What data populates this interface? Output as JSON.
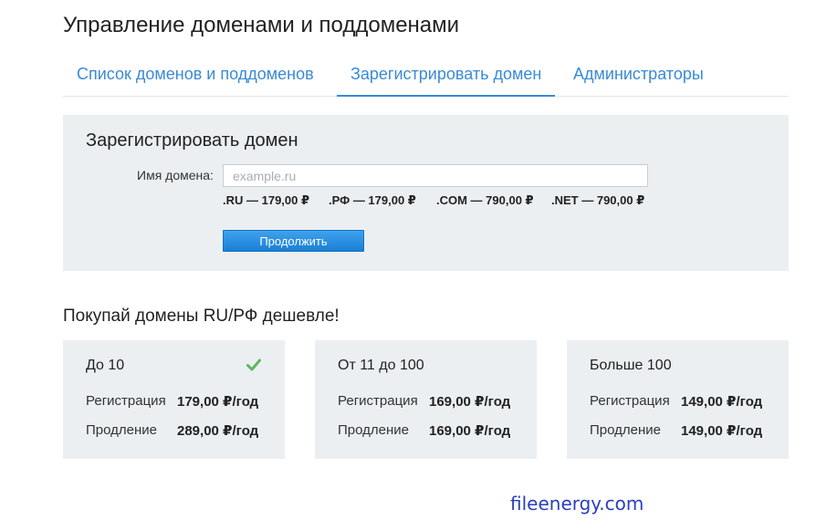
{
  "header": {
    "title": "Управление доменами и поддоменами"
  },
  "tabs": [
    {
      "label": "Список доменов и поддоменов",
      "active": false
    },
    {
      "label": "Зарегистрировать домен",
      "active": true
    },
    {
      "label": "Администраторы",
      "active": false
    }
  ],
  "register": {
    "title": "Зарегистрировать домен",
    "field_label": "Имя домена:",
    "placeholder": "example.ru",
    "value": "",
    "prices": [
      ".RU — 179,00 ₽",
      ".РФ — 179,00 ₽",
      ".COM — 790,00 ₽",
      ".NET — 790,00 ₽"
    ],
    "continue_label": "Продолжить"
  },
  "promo": {
    "title": "Покупай домены RU/РФ дешевле!",
    "tiers": [
      {
        "name": "До 10",
        "selected": true,
        "rows": [
          {
            "label": "Регистрация",
            "value": "179,00 ₽/год"
          },
          {
            "label": "Продление",
            "value": "289,00 ₽/год"
          }
        ]
      },
      {
        "name": "От 11 до 100",
        "selected": false,
        "rows": [
          {
            "label": "Регистрация",
            "value": "169,00 ₽/год"
          },
          {
            "label": "Продление",
            "value": "169,00 ₽/год"
          }
        ]
      },
      {
        "name": "Больше 100",
        "selected": false,
        "rows": [
          {
            "label": "Регистрация",
            "value": "149,00 ₽/год"
          },
          {
            "label": "Продление",
            "value": "149,00 ₽/год"
          }
        ]
      }
    ]
  },
  "watermark": "fileenergy.com",
  "colors": {
    "accent": "#3a8ad6",
    "panel": "#eceff1",
    "button": "#1a7fd4",
    "check": "#5cb85c"
  },
  "icons": {
    "selected_tier": "check-icon"
  }
}
